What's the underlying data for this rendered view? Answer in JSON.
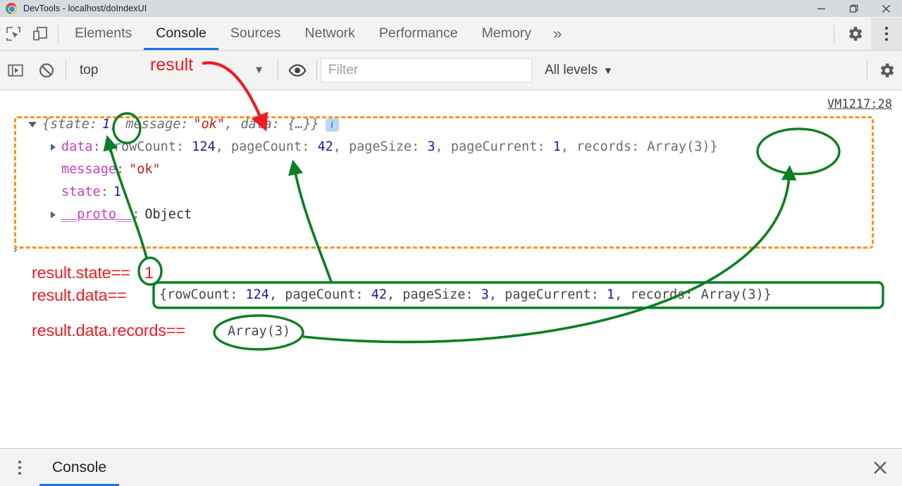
{
  "window": {
    "title": "DevTools - localhost/doIndexUI",
    "logo_icon": "chrome-logo-icon",
    "minimize_label": "Minimize",
    "maximize_label": "Restore",
    "close_label": "Close"
  },
  "tabbar": {
    "inspect_icon": "inspect-element-icon",
    "device_icon": "device-toolbar-icon",
    "tabs": [
      {
        "label": "Elements",
        "active": false
      },
      {
        "label": "Console",
        "active": true
      },
      {
        "label": "Sources",
        "active": false
      },
      {
        "label": "Network",
        "active": false
      },
      {
        "label": "Performance",
        "active": false
      },
      {
        "label": "Memory",
        "active": false
      }
    ],
    "more_label": "»",
    "settings_icon": "gear-icon",
    "menu_icon": "kebab-menu-icon"
  },
  "console_toolbar": {
    "sidebar_icon": "console-sidebar-icon",
    "clear_icon": "clear-console-icon",
    "context": "top",
    "context_caret": "▼",
    "eye_icon": "live-expression-icon",
    "filter_placeholder": "Filter",
    "filter_value": "",
    "levels": "All levels",
    "levels_caret": "▼",
    "settings_icon": "gear-icon"
  },
  "console": {
    "source_link": "VM1217:28",
    "prompt_caret": "›",
    "preview": {
      "open": "{state:",
      "state_value": "1",
      "mid": ", message:",
      "message_value": "\"ok\"",
      "tail": ", data: {…}}",
      "info_badge": "i"
    },
    "properties": [
      {
        "name": "data",
        "sep": ":",
        "value": "{rowCount: 124, pageCount: 42, pageSize: 3, pageCurrent: 1, records: Array(3)}",
        "expandable": true
      },
      {
        "name": "message",
        "sep": ":",
        "value": "\"ok\"",
        "expandable": false
      },
      {
        "name": "state",
        "sep": ":",
        "value": "1",
        "expandable": false
      },
      {
        "name": "__proto__",
        "sep": ":",
        "value": "Object",
        "expandable": true
      }
    ],
    "data_parts": {
      "p1": "{rowCount: ",
      "n1": "124",
      "p2": ", pageCount: ",
      "n2": "42",
      "p3": ", pageSize: ",
      "n3": "3",
      "p4": ", pageCurrent: ",
      "n4": "1",
      "p5": ", records: Array(3)}"
    }
  },
  "annotations": {
    "result_label": "result",
    "line1_label": "result.state==",
    "line1_value": "1",
    "line2_label": "result.data==",
    "line2_value": "{rowCount: 124, pageCount: 42, pageSize: 3, pageCurrent: 1, records: Array(3)}",
    "line3_label": "result.data.records==",
    "line3_value": "Array(3)",
    "colors": {
      "red": "#ec1c24",
      "green": "#0a7f24",
      "orange": "#f7941e",
      "accent_blue": "#1a73e8"
    }
  },
  "drawer": {
    "menu_icon": "kebab-menu-icon",
    "tab_label": "Console",
    "close_icon": "close-icon"
  }
}
